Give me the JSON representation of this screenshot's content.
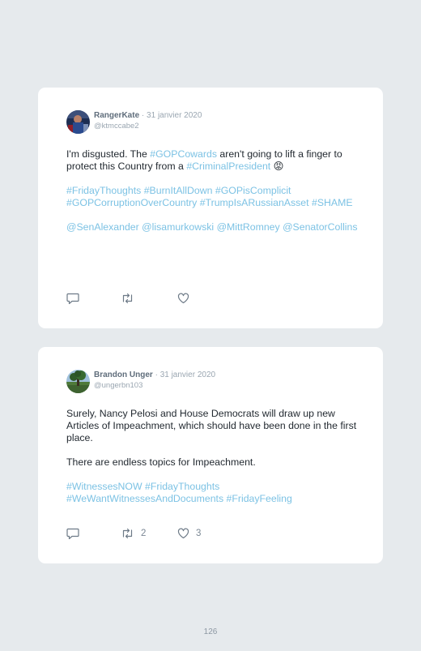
{
  "tweets": [
    {
      "author": "RangerKate",
      "separator": "·",
      "date": "31 janvier 2020",
      "handle": "@ktmccabe2",
      "paragraphs": [
        [
          {
            "text": "I'm disgusted. The ",
            "tag": false
          },
          {
            "text": "#GOPCowards",
            "tag": true
          },
          {
            "text": " aren't going to lift a finger to protect this Country from a ",
            "tag": false
          },
          {
            "text": "#CriminalPresident",
            "tag": true
          },
          {
            "text": " 😡",
            "tag": false
          }
        ],
        [
          {
            "text": "#FridayThoughts #BurnItAllDown #GOPisComplicit #GOPCorruptionOverCountry #TrumpIsARussianAsset #SHAME",
            "tag": true
          }
        ],
        [
          {
            "text": "@SenAlexander @lisamurkowski @MittRomney @SenatorCollins",
            "tag": true
          }
        ]
      ],
      "retweets": "",
      "likes": ""
    },
    {
      "author": "Brandon Unger",
      "separator": "·",
      "date": "31 janvier 2020",
      "handle": "@ungerbn103",
      "paragraphs": [
        [
          {
            "text": "Surely, Nancy Pelosi and House Democrats will draw up new Articles of Impeachment, which should have been done in the first place.",
            "tag": false
          }
        ],
        [
          {
            "text": "There are endless topics for Impeachment.",
            "tag": false
          }
        ],
        [
          {
            "text": "#WitnessesNOW #FridayThoughts #WeWantWitnessesAndDocuments #FridayFeeling",
            "tag": true
          }
        ]
      ],
      "retweets": "2",
      "likes": "3"
    }
  ],
  "icons": {
    "reply": "speech-bubble-icon",
    "retweet": "retweet-arrows-icon",
    "like": "heart-icon"
  },
  "colors": {
    "background": "#e6eaed",
    "card": "#ffffff",
    "hashtag": "#7cc2e4",
    "text": "#232a31",
    "muted": "#9aa6b1"
  },
  "page_number": "126"
}
